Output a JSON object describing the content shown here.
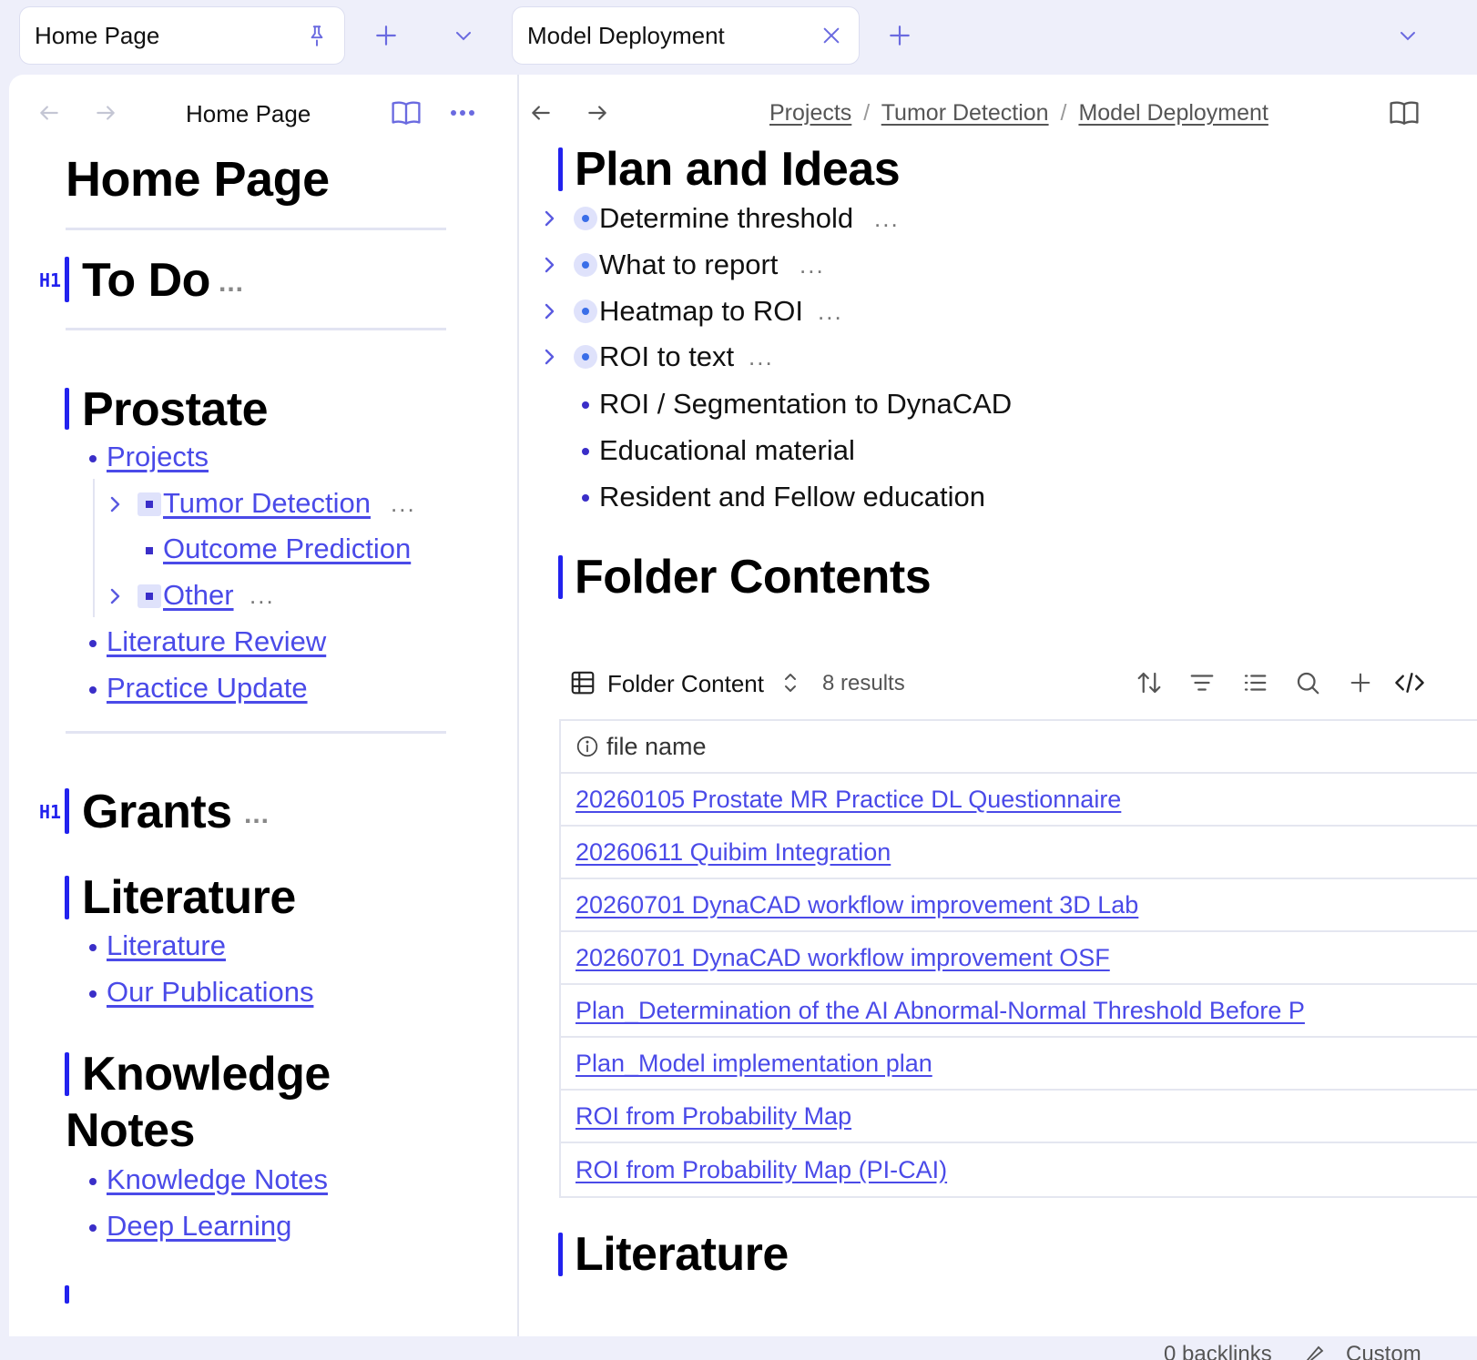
{
  "tabs": {
    "left": {
      "label": "Home Page"
    },
    "right": {
      "label": "Model Deployment"
    }
  },
  "left_pane": {
    "header_title": "Home Page",
    "page_title": "Home Page",
    "todo": {
      "tag": "H1",
      "title": "To Do",
      "more": "..."
    },
    "prostate": {
      "title": "Prostate",
      "items": [
        "Projects",
        "Literature Review",
        "Practice Update"
      ],
      "sub_items": [
        "Tumor Detection",
        "Outcome Prediction",
        "Other"
      ],
      "sub_more": "..."
    },
    "grants": {
      "tag": "H1",
      "title": "Grants",
      "more": "..."
    },
    "literature": {
      "title": "Literature",
      "items": [
        "Literature",
        "Our Publications"
      ]
    },
    "knowledge": {
      "title_line1": "Knowledge",
      "title_line2": "Notes",
      "items": [
        "Knowledge Notes",
        "Deep Learning"
      ]
    }
  },
  "right_pane": {
    "breadcrumb": [
      "Projects",
      "Tumor Detection",
      "Model Deployment"
    ],
    "breadcrumb_sep": "/",
    "plan": {
      "title": "Plan and Ideas",
      "collapsed_items": [
        "Determine threshold",
        "What to report",
        "Heatmap to ROI",
        "ROI to text"
      ],
      "more": "...",
      "items": [
        "ROI / Segmentation to DynaCAD",
        "Educational material",
        "Resident and Fellow education"
      ]
    },
    "folder": {
      "title": "Folder Contents",
      "view_name": "Folder Content",
      "results": "8 results",
      "column": "file name",
      "rows": [
        "20260105 Prostate MR Practice DL Questionnaire",
        "20260611 Quibim Integration",
        "20260701 DynaCAD workflow improvement 3D Lab",
        "20260701 DynaCAD workflow improvement OSF",
        "Plan_Determination of the AI Abnormal-Normal Threshold Before P",
        "Plan_Model implementation plan",
        "ROI from Probability Map",
        "ROI from Probability Map (PI-CAI)"
      ]
    },
    "literature_title": "Literature",
    "status": {
      "backlinks": "0 backlinks",
      "custom": "Custom"
    }
  }
}
